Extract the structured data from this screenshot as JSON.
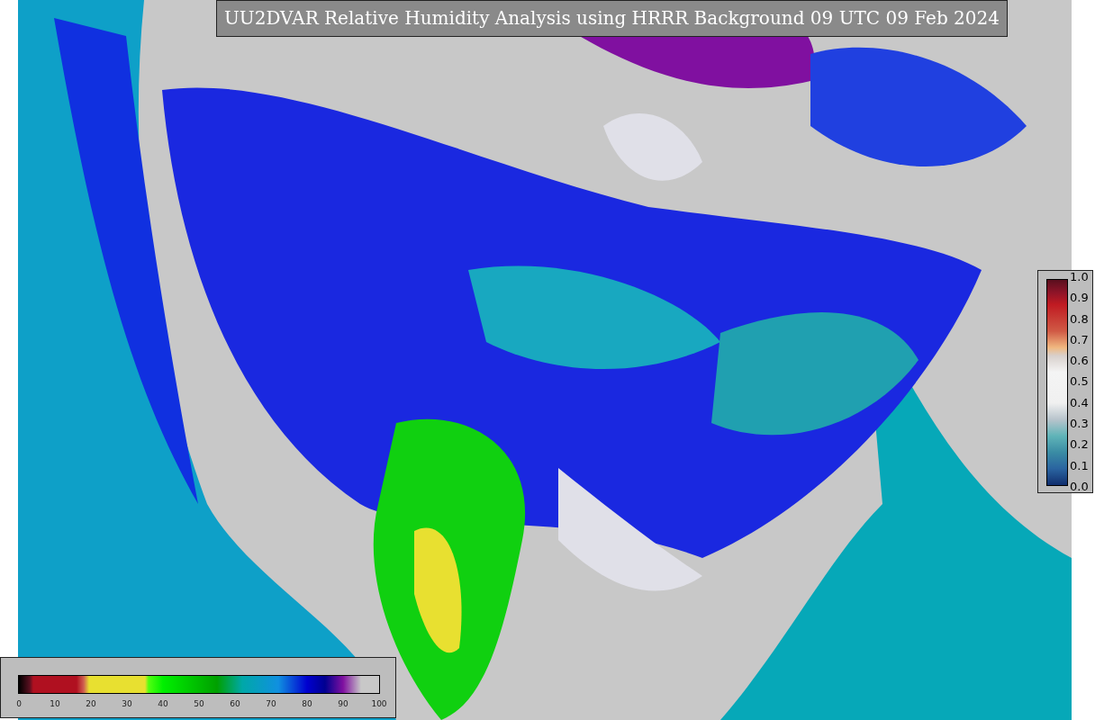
{
  "title": "UU2DVAR Relative Humidity Analysis using HRRR Background 09 UTC 09 Feb 2024",
  "error_colorbar": {
    "ticks": [
      "1.0",
      "0.9",
      "0.8",
      "0.7",
      "0.6",
      "0.5",
      "0.4",
      "0.3",
      "0.2",
      "0.1",
      "0.0"
    ]
  },
  "humidity_colorbar": {
    "ticks": [
      "0",
      "10",
      "20",
      "30",
      "40",
      "50",
      "60",
      "70",
      "80",
      "90",
      "100"
    ]
  }
}
